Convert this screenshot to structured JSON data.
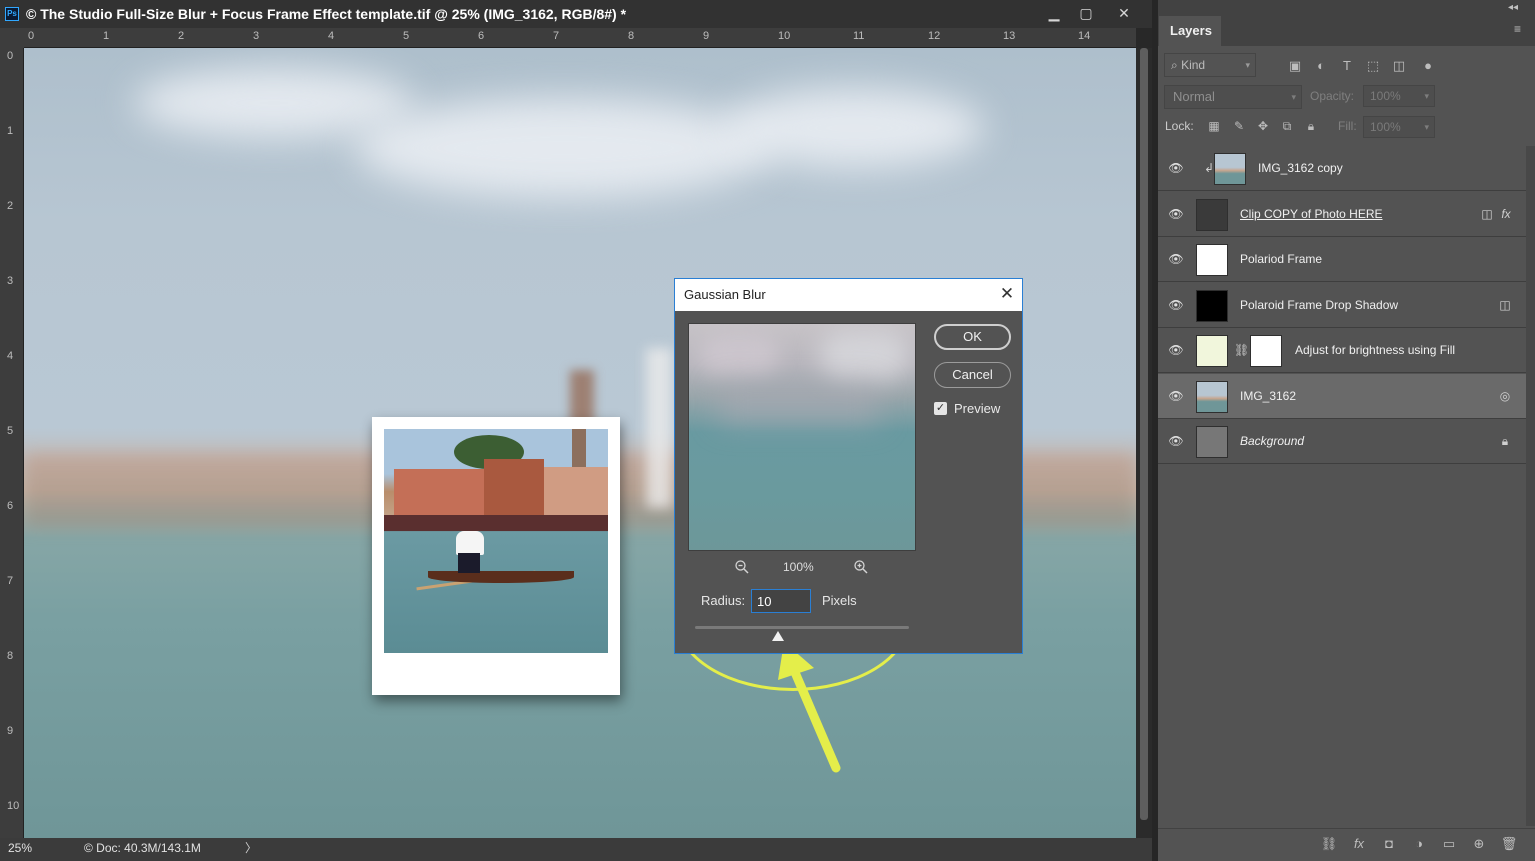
{
  "window": {
    "title": "© The Studio Full-Size Blur + Focus Frame Effect template.tif @ 25% (IMG_3162, RGB/8#) *",
    "app_icon": "Ps",
    "minimize_icon": "minimize-icon",
    "maximize_icon": "maximize-icon",
    "close_icon": "close-icon"
  },
  "rulers": {
    "horizontal": [
      "0",
      "1",
      "2",
      "3",
      "4",
      "5",
      "6",
      "7",
      "8",
      "9",
      "10",
      "11",
      "12",
      "13",
      "14"
    ],
    "vertical": [
      "0",
      "1",
      "2",
      "3",
      "4",
      "5",
      "6",
      "7",
      "8",
      "9",
      "10"
    ]
  },
  "status": {
    "zoom": "25%",
    "doc_info": "© Doc: 40.3M/143.1M",
    "arrow": "〉"
  },
  "dialog": {
    "title": "Gaussian Blur",
    "close": "✕",
    "ok_label": "OK",
    "cancel_label": "Cancel",
    "preview_label": "Preview",
    "preview_checked": true,
    "zoom_level": "100%",
    "radius_label": "Radius:",
    "radius_value": "10",
    "radius_unit": "Pixels",
    "radius_slider_fraction": 0.39
  },
  "layers_panel": {
    "tab_label": "Layers",
    "kind_filter": "Kind",
    "blend_mode": "Normal",
    "opacity_label": "Opacity:",
    "opacity_value": "100%",
    "lock_label": "Lock:",
    "fill_label": "Fill:",
    "fill_value": "100%",
    "layers": [
      {
        "name": "IMG_3162 copy",
        "thumb": "photo",
        "clipped": true,
        "selected": false,
        "italic": false,
        "underline": false,
        "right_icon": ""
      },
      {
        "name": "Clip COPY of Photo HERE",
        "thumb": "text",
        "clipped": false,
        "selected": false,
        "italic": false,
        "underline": true,
        "right_icon": "fx"
      },
      {
        "name": "Polariod Frame",
        "thumb": "white",
        "clipped": false,
        "selected": false,
        "italic": false,
        "underline": false,
        "right_icon": ""
      },
      {
        "name": "Polaroid Frame Drop Shadow",
        "thumb": "black",
        "clipped": false,
        "selected": false,
        "italic": false,
        "underline": false,
        "right_icon": "smart-object-icon"
      },
      {
        "name": "Adjust for brightness using Fill",
        "thumb": "cream",
        "clipped": false,
        "selected": false,
        "italic": false,
        "underline": false,
        "right_icon": ""
      },
      {
        "name": "IMG_3162",
        "thumb": "photo",
        "clipped": false,
        "selected": true,
        "italic": false,
        "underline": false,
        "right_icon": "smart-filter-icon"
      },
      {
        "name": "Background",
        "thumb": "gray",
        "clipped": false,
        "selected": false,
        "italic": true,
        "underline": false,
        "right_icon": "lock-icon"
      }
    ]
  },
  "colors": {
    "accent": "#2a7fd4",
    "highlight": "#e4ee4a",
    "panel_bg": "#535353"
  }
}
